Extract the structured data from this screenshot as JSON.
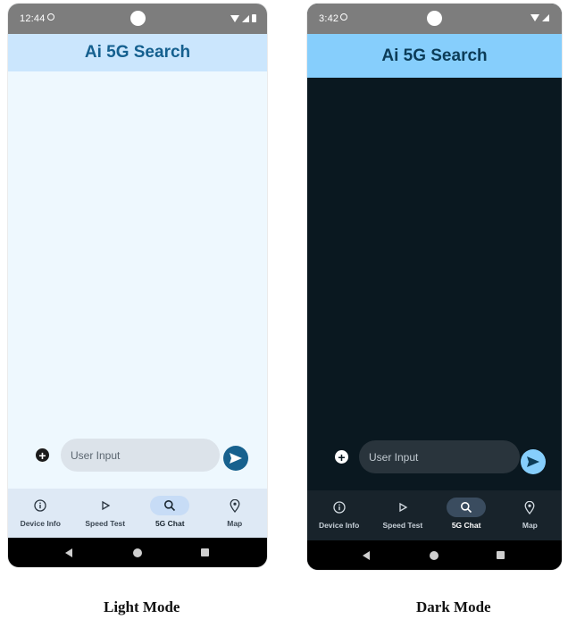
{
  "light": {
    "status": {
      "time": "12:44"
    },
    "app_title": "Ai 5G Search",
    "input": {
      "placeholder": "User Input"
    },
    "nav": [
      {
        "label": "Device Info",
        "icon": "info-icon"
      },
      {
        "label": "Speed Test",
        "icon": "play-icon"
      },
      {
        "label": "5G Chat",
        "icon": "search-icon",
        "active": true
      },
      {
        "label": "Map",
        "icon": "map-pin-icon"
      }
    ],
    "caption": "Light Mode"
  },
  "dark": {
    "status": {
      "time": "3:42"
    },
    "app_title": "Ai 5G Search",
    "input": {
      "placeholder": "User Input"
    },
    "nav": [
      {
        "label": "Device Info",
        "icon": "info-icon"
      },
      {
        "label": "Speed Test",
        "icon": "play-icon"
      },
      {
        "label": "5G Chat",
        "icon": "search-icon",
        "active": true
      },
      {
        "label": "Map",
        "icon": "map-pin-icon"
      }
    ],
    "caption": "Dark Mode"
  },
  "colors": {
    "light_bg": "#eef8fe",
    "light_appbar": "#cbe6fd",
    "light_accent": "#17618e",
    "dark_bg": "#0a1820",
    "dark_appbar": "#86cefc",
    "dark_accent": "#86cefc"
  }
}
